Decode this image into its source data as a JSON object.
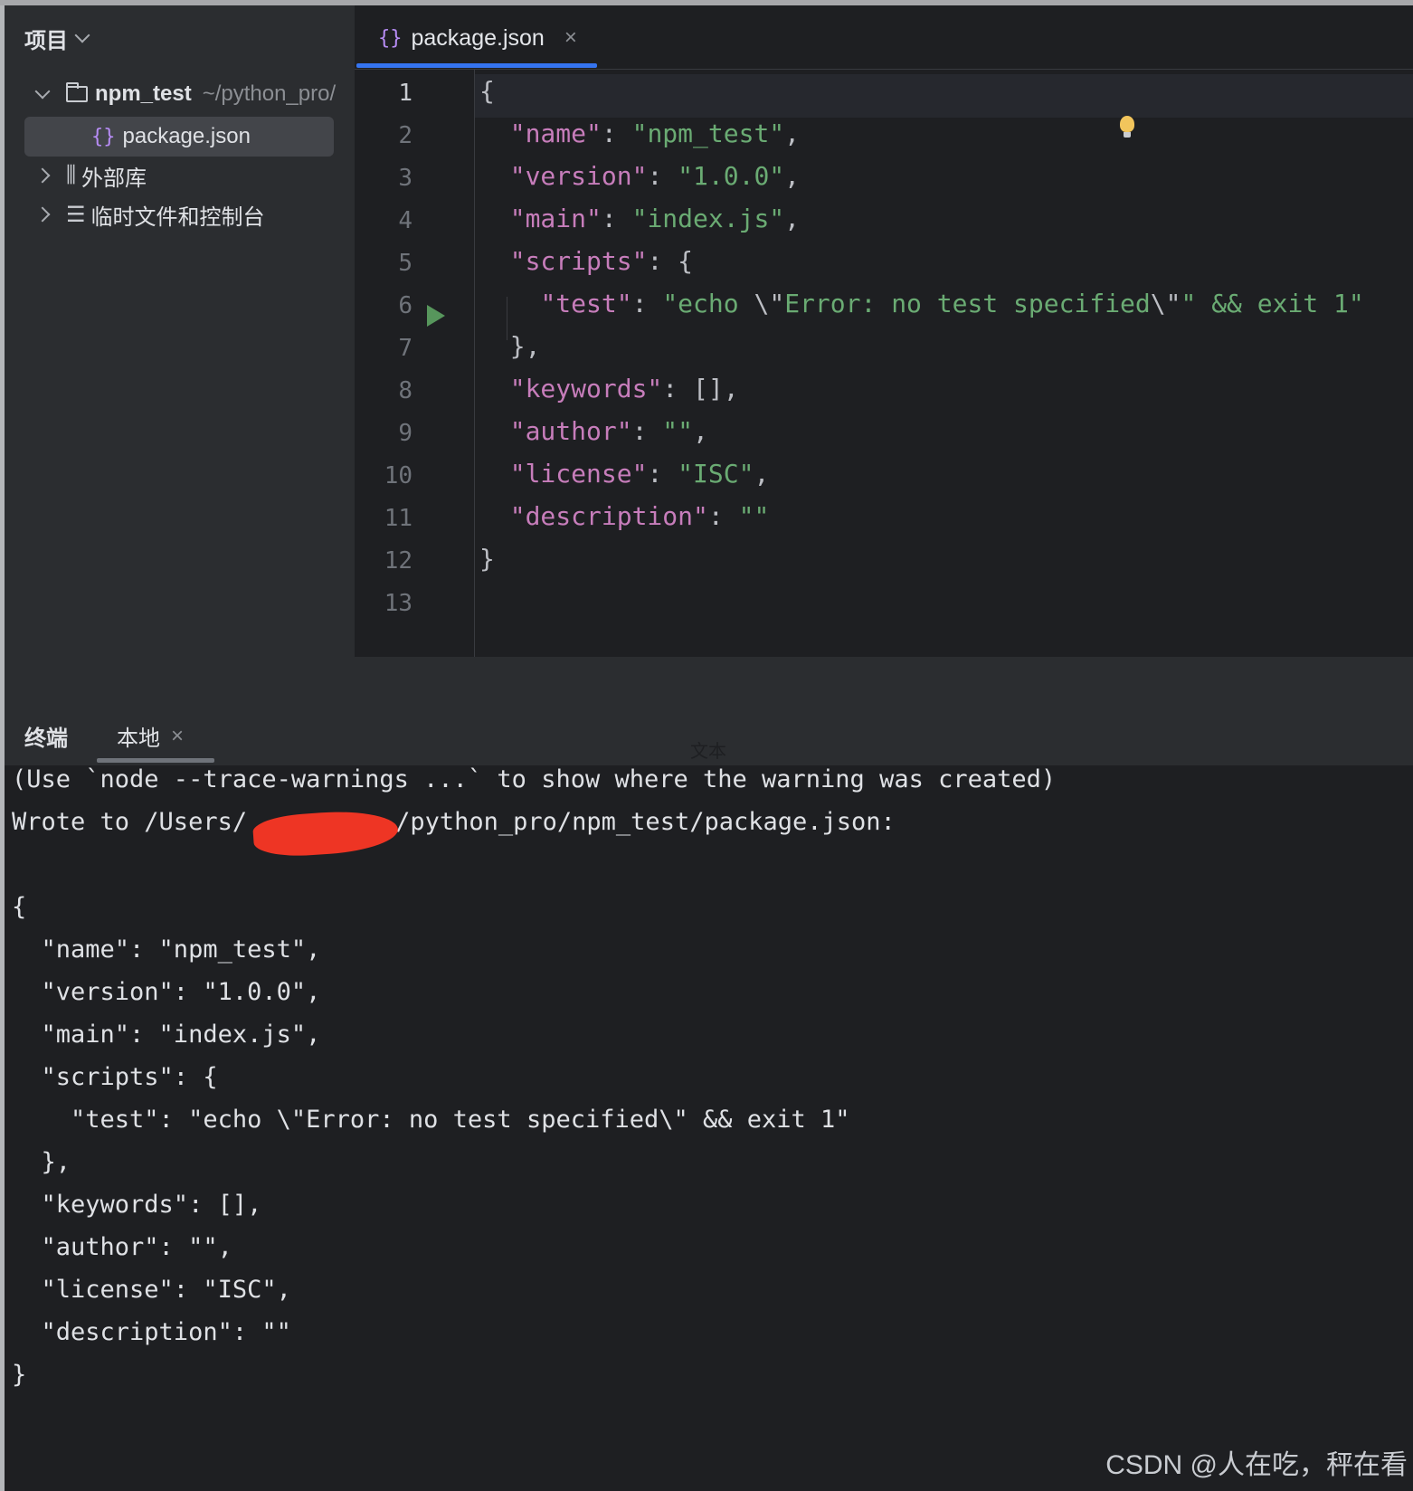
{
  "sidebar": {
    "title": "项目",
    "tree": [
      {
        "name": "npm_test",
        "path": "~/python_pro/",
        "icon": "folder-icon"
      },
      {
        "name": "package.json",
        "icon": "json-braces-icon"
      },
      {
        "name": "外部库",
        "icon": "library-icon"
      },
      {
        "name": "临时文件和控制台",
        "icon": "scratch-console-icon"
      }
    ]
  },
  "editor": {
    "tab_label": "package.json",
    "tab_icon": "{}",
    "line_numbers": [
      "1",
      "2",
      "3",
      "4",
      "5",
      "6",
      "7",
      "8",
      "9",
      "10",
      "11",
      "12",
      "13"
    ],
    "code": {
      "l1": "{",
      "l2_key": "\"name\"",
      "l2_val": "\"npm_test\"",
      "l3_key": "\"version\"",
      "l3_val": "\"1.0.0\"",
      "l4_key": "\"main\"",
      "l4_val": "\"index.js\"",
      "l5_key": "\"scripts\"",
      "l5_rest": ": {",
      "l6_key": "\"test\"",
      "l6_val_a": "\"echo ",
      "l6_esc1": "\\\"",
      "l6_val_b": "Error: no test specified",
      "l6_esc2": "\\\"",
      "l6_val_c": "\" && exit 1\"",
      "l7": "},",
      "l8_key": "\"keywords\"",
      "l8_rest": ": [],",
      "l9_key": "\"author\"",
      "l9_val": "\"\"",
      "l10_key": "\"license\"",
      "l10_val": "\"ISC\"",
      "l11_key": "\"description\"",
      "l11_val": "\"\"",
      "l12": "}"
    }
  },
  "terminal": {
    "title": "终端",
    "tab_label": "本地",
    "tooltip": "文本",
    "lines": [
      "(Use `node --trace-warnings ...` to show where the warning was created)",
      "Wrote to /Users/",
      "/python_pro/npm_test/package.json:",
      "",
      "{",
      "  \"name\": \"npm_test\",",
      "  \"version\": \"1.0.0\",",
      "  \"main\": \"index.js\",",
      "  \"scripts\": {",
      "    \"test\": \"echo \\\"Error: no test specified\\\" && exit 1\"",
      "  },",
      "  \"keywords\": [],",
      "  \"author\": \"\",",
      "  \"license\": \"ISC\",",
      "  \"description\": \"\"",
      "}"
    ]
  },
  "watermark": "CSDN @人在吃，秤在看",
  "colors": {
    "accent": "#3574f0",
    "string": "#6aab73",
    "key": "#c77dbb",
    "run": "#57965c",
    "redaction": "#ee3524"
  }
}
